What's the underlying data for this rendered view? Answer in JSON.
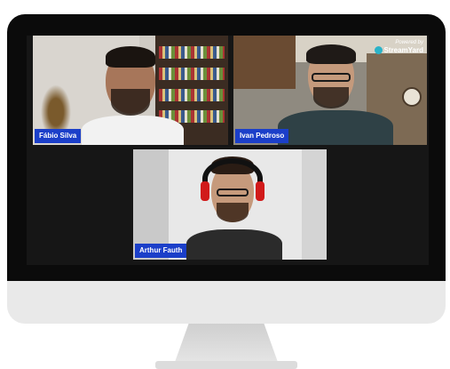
{
  "participants": [
    {
      "name": "Fábio Silva"
    },
    {
      "name": "Ivan Pedroso"
    },
    {
      "name": "Arthur Fauth"
    }
  ],
  "branding": {
    "powered_by": "Powered by",
    "logo_text": "StreamYard",
    "icon": "streamyard-logo-icon"
  },
  "colors": {
    "name_tag": "#1b3fc9",
    "screen_background": "#161616",
    "monitor_bezel": "#0b0b0b",
    "monitor_chin": "#e9e9e9"
  }
}
